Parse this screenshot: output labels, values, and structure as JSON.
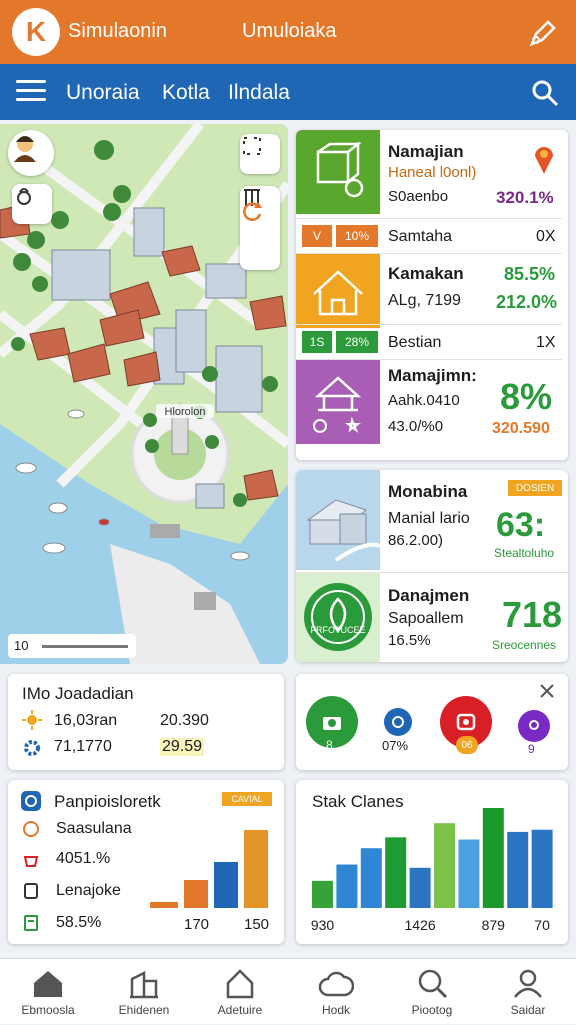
{
  "header": {
    "logo_text": "K",
    "app_name": "Simulaonin",
    "title": "Umuloiaka"
  },
  "nav": {
    "items": [
      "Unoraia",
      "Kotla",
      "Ilndala"
    ]
  },
  "map": {
    "landmark_label": "Hlorolon",
    "scale_label": "10"
  },
  "panel": {
    "cards": [
      {
        "name": "Namajian",
        "line1": "Haneal l0onl)",
        "line2": "S0aenbo",
        "value": "320.1%",
        "color": "#5aa72f"
      },
      {
        "name": "Kamakan",
        "line1": "ALg, 7199",
        "value1": "85.5%",
        "value2": "212.0%",
        "color": "#f0a41f"
      },
      {
        "name": "Mamajimn:",
        "line1": "Aahk.0410",
        "line2": "43.0/%0",
        "big": "8%",
        "value": "320.590",
        "color": "#a75eb4"
      }
    ],
    "rows": [
      {
        "chip1": "V",
        "chip2": "10%",
        "label": "Samtaha",
        "right": "0X"
      },
      {
        "chip1": "1S",
        "chip2": "28%",
        "label": "Bestian",
        "right": "1X"
      }
    ]
  },
  "cards2": [
    {
      "name": "Monabina",
      "badge": "DOSIEN",
      "line1": "Manial lario",
      "line2": "86.2.00)",
      "big": "63:",
      "caption": "Stealtoluho"
    },
    {
      "name": "Danajmen",
      "line1": "Sapoallem",
      "line2": "16.5%",
      "big": "718",
      "caption": "Sreocennes",
      "ring_label": "FRFOTUCEE"
    }
  ],
  "info": {
    "title": "IMo Joadadian",
    "rows": [
      {
        "a": "16,03ran",
        "b": "20.390"
      },
      {
        "a": "71,1770",
        "b": "29.59"
      }
    ]
  },
  "circles": {
    "labels": [
      "",
      "07%",
      "",
      "9"
    ],
    "sub": [
      "8",
      "",
      "06",
      ""
    ]
  },
  "left_chart": {
    "title": "Panpioisloretk",
    "badge": "CAVIAL",
    "items": [
      "Saasulana",
      "4051.%",
      "Lenajoke",
      "58.5%"
    ],
    "ticks": [
      "170",
      "150"
    ]
  },
  "chart_data": {
    "type": "bar",
    "title": "Stak Clanes",
    "categories": [
      "930",
      "",
      "",
      "",
      "1426",
      "",
      "",
      "879",
      "",
      "70"
    ],
    "values": [
      25,
      40,
      55,
      65,
      37,
      78,
      63,
      92,
      70,
      72
    ],
    "colors": [
      "#35a33a",
      "#2f86d4",
      "#2f86d4",
      "#1f9a34",
      "#2a74c2",
      "#7bc247",
      "#4aa0e0",
      "#1a9a2a",
      "#2a74c2",
      "#2a74c2"
    ]
  },
  "bottom_nav": [
    "Ebmoosla",
    "Ehidenen",
    "Adetuire",
    "Hodk",
    "Piootog",
    "Saidar"
  ],
  "theme": {
    "orange": "#e4782a",
    "blue": "#1f66b5",
    "green": "#2a9a3a"
  }
}
